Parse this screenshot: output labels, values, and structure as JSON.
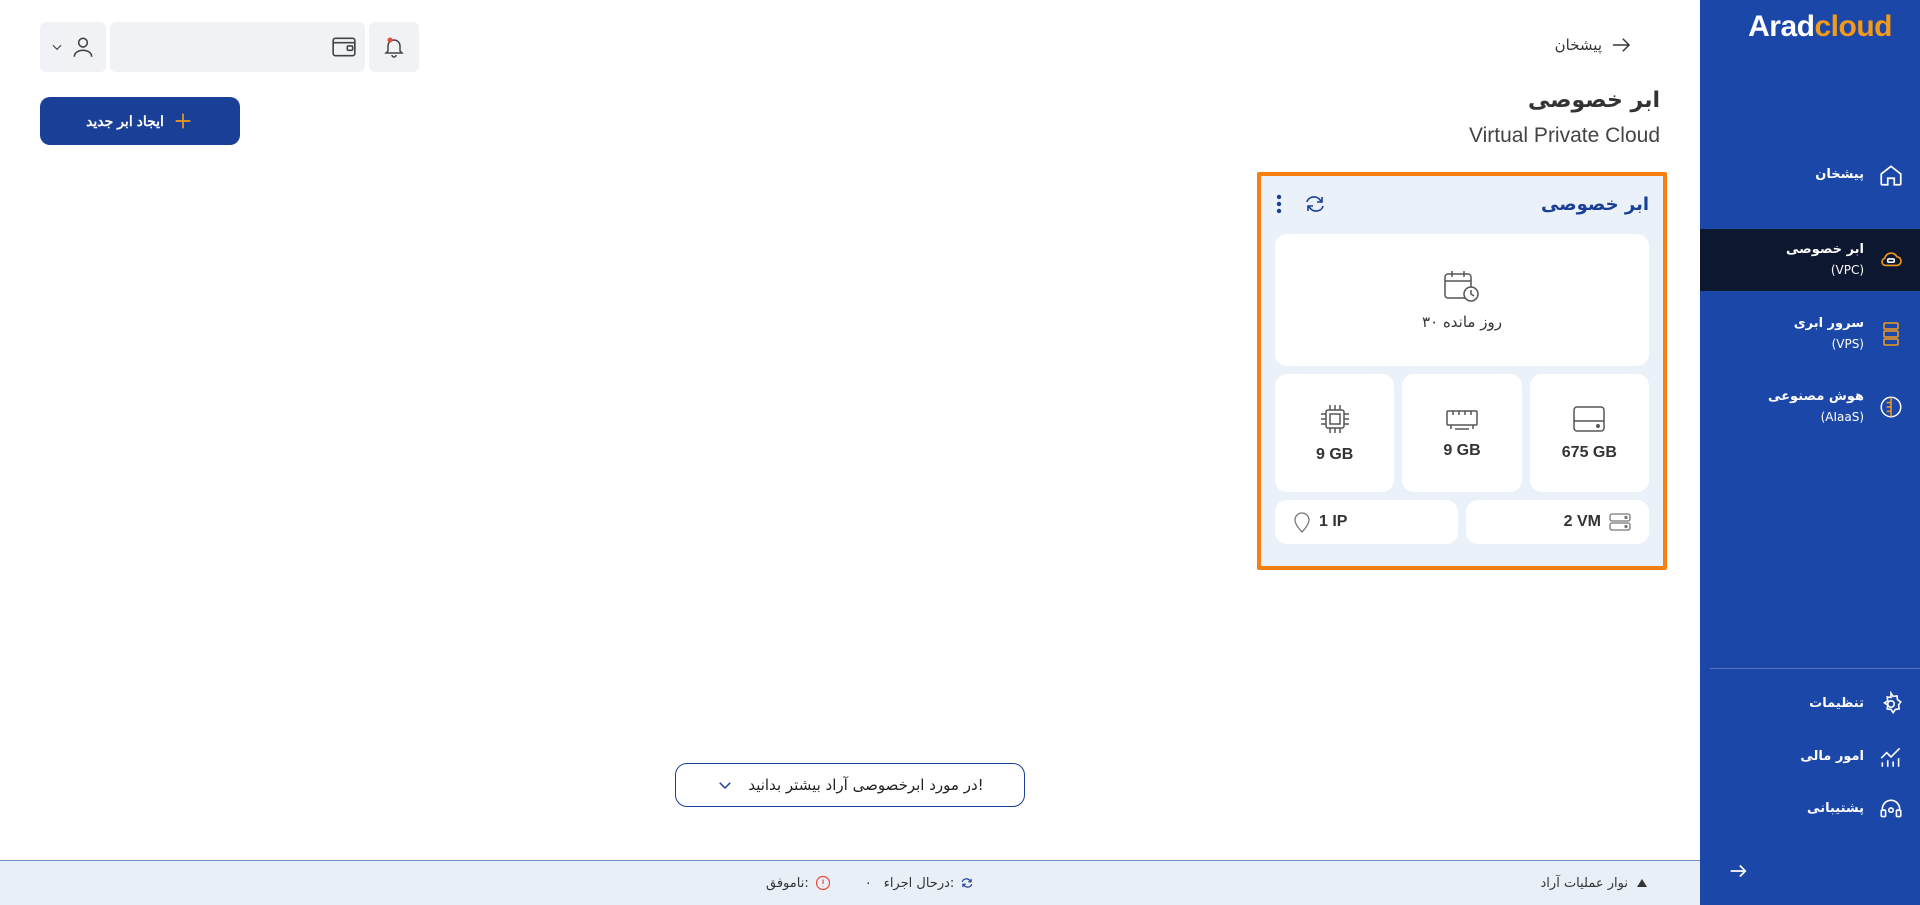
{
  "brand": {
    "part1": "Arad",
    "part2": "cloud",
    "accent": "#f39a1b",
    "sidebar_bg": "#1b47a8"
  },
  "sidebar": {
    "items": [
      {
        "label": "پیشخان",
        "sub": "",
        "icon": "home-icon"
      },
      {
        "label": "ابر خصوصی",
        "sub": "(VPC)",
        "icon": "cloud-network-icon",
        "active": true
      },
      {
        "label": "سرور ابری",
        "sub": "(VPS)",
        "icon": "server-icon"
      },
      {
        "label": "هوش مصنوعی",
        "sub": "(AIaaS)",
        "icon": "ai-brain-icon"
      }
    ],
    "bottom": [
      {
        "label": "تنظیمات",
        "icon": "gear-icon"
      },
      {
        "label": "امور مالی",
        "icon": "finance-chart-icon"
      },
      {
        "label": "پشتیبانی",
        "icon": "headset-icon"
      }
    ]
  },
  "header": {
    "breadcrumb": "پیشخان",
    "title": "ابر خصوصی",
    "subtitle": "Virtual Private Cloud",
    "create_button": "ایجاد ابر جدید"
  },
  "card": {
    "title": "ابر خصوصی",
    "days_left": "۳۰ روز مانده",
    "resources": [
      {
        "icon": "disk-icon",
        "value": "675 GB"
      },
      {
        "icon": "ram-icon",
        "value": "9 GB"
      },
      {
        "icon": "cpu-icon",
        "value": "9 GB"
      }
    ],
    "vm": "2 VM",
    "ip": "1 IP",
    "highlight_color": "#f57f0f"
  },
  "learn_more": "در مورد ابرخصوصی آراد بیشتر بدانید!",
  "opsbar": {
    "toggle_label": "نوار عملیات آراد",
    "running_label": "درحال اجراء:",
    "running_count": "۰",
    "failed_label": "ناموفق:"
  }
}
